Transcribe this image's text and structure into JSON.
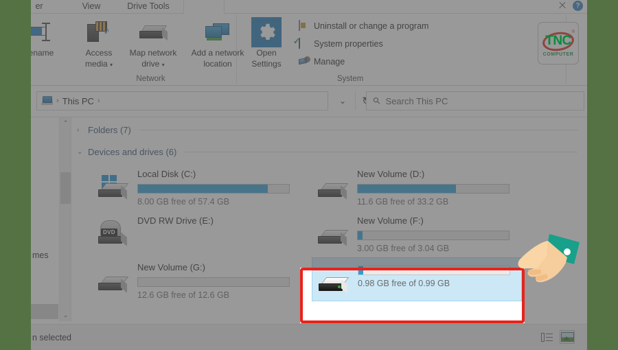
{
  "window": {
    "title_tabs": [
      {
        "label": "er",
        "name": "tab-share",
        "active": false
      },
      {
        "label": "View",
        "name": "tab-view",
        "active": false
      },
      {
        "label": "Drive Tools",
        "name": "tab-drive-tools",
        "active": false
      },
      {
        "label": "",
        "name": "tab-manage",
        "active": true
      }
    ],
    "close_label": "✕",
    "help_label": "?"
  },
  "logo": {
    "mark": "TNC",
    "registered": "®",
    "subtitle": "COMPUTER",
    "green": "#0a8a3c",
    "red": "#e2231a"
  },
  "ribbon": {
    "groups": [
      {
        "name": "network",
        "label": "Network"
      },
      {
        "name": "system",
        "label": "System"
      }
    ],
    "big_buttons": [
      {
        "name": "rename-button",
        "line1": "ename",
        "line2": "",
        "caret": false,
        "icon": "rename-icon"
      },
      {
        "name": "access-media-button",
        "line1": "Access",
        "line2": "media",
        "caret": true,
        "icon": "media-server-icon"
      },
      {
        "name": "map-network-drive-button",
        "line1": "Map network",
        "line2": "drive",
        "caret": true,
        "icon": "network-drive-icon"
      },
      {
        "name": "add-network-location-button",
        "line1": "Add a network",
        "line2": "location",
        "caret": false,
        "icon": "network-monitor-icon"
      },
      {
        "name": "open-settings-button",
        "line1": "Open",
        "line2": "Settings",
        "caret": false,
        "icon": "gear-icon"
      }
    ],
    "small_buttons": [
      {
        "name": "uninstall-or-change-program-button",
        "label": "Uninstall or change a program",
        "icon": "programs-icon"
      },
      {
        "name": "system-properties-button",
        "label": "System properties",
        "icon": "system-properties-icon"
      },
      {
        "name": "manage-button",
        "label": "Manage",
        "icon": "manage-icon"
      }
    ]
  },
  "address": {
    "crumb_icon": "this-pc-icon",
    "crumbs": [
      "This PC"
    ],
    "separator": "›",
    "dropdown_caret": "⌄",
    "refresh_glyph": "↻",
    "search_placeholder": "Search This PC",
    "search_value": ""
  },
  "content": {
    "nav_partial_text": "mes",
    "groups": [
      {
        "name": "group-folders",
        "caret": "›",
        "label": "Folders (7)",
        "expanded": false
      },
      {
        "name": "group-devices-and-drives",
        "caret": "⌄",
        "label": "Devices and drives (6)",
        "expanded": true
      }
    ],
    "drives": [
      {
        "name": "Local Disk (C:)",
        "free_text": "8.00 GB free of 57.4 GB",
        "fill_percent": 86,
        "icon": "windows-drive-icon",
        "selected": false,
        "show_bar": true
      },
      {
        "name": "New Volume (D:)",
        "free_text": "11.6 GB free of 33.2 GB",
        "fill_percent": 65,
        "icon": "drive-icon",
        "selected": false,
        "show_bar": true
      },
      {
        "name": "DVD RW Drive (E:)",
        "free_text": "",
        "fill_percent": 0,
        "icon": "dvd-drive-icon",
        "selected": false,
        "show_bar": false
      },
      {
        "name": "New Volume (F:)",
        "free_text": "3.00 GB free of 3.04 GB",
        "fill_percent": 3,
        "icon": "drive-icon",
        "selected": false,
        "show_bar": true
      },
      {
        "name": "New Volume (G:)",
        "free_text": "12.6 GB free of 12.6 GB",
        "fill_percent": 0,
        "icon": "drive-icon",
        "selected": false,
        "show_bar": true
      },
      {
        "name": "",
        "free_text": "0.98 GB free of 0.99 GB",
        "fill_percent": 3,
        "icon": "usb-drive-icon",
        "selected": true,
        "show_bar": true
      }
    ]
  },
  "statusbar": {
    "text": "n selected",
    "view_buttons": [
      {
        "name": "view-details-button",
        "icon": "details-view-icon",
        "active": false
      },
      {
        "name": "view-large-icons-button",
        "icon": "large-icons-view-icon",
        "active": true
      }
    ]
  },
  "annotations": {
    "highlight_color": "#e8231c",
    "cursor": "pointing-hand-cursor"
  }
}
